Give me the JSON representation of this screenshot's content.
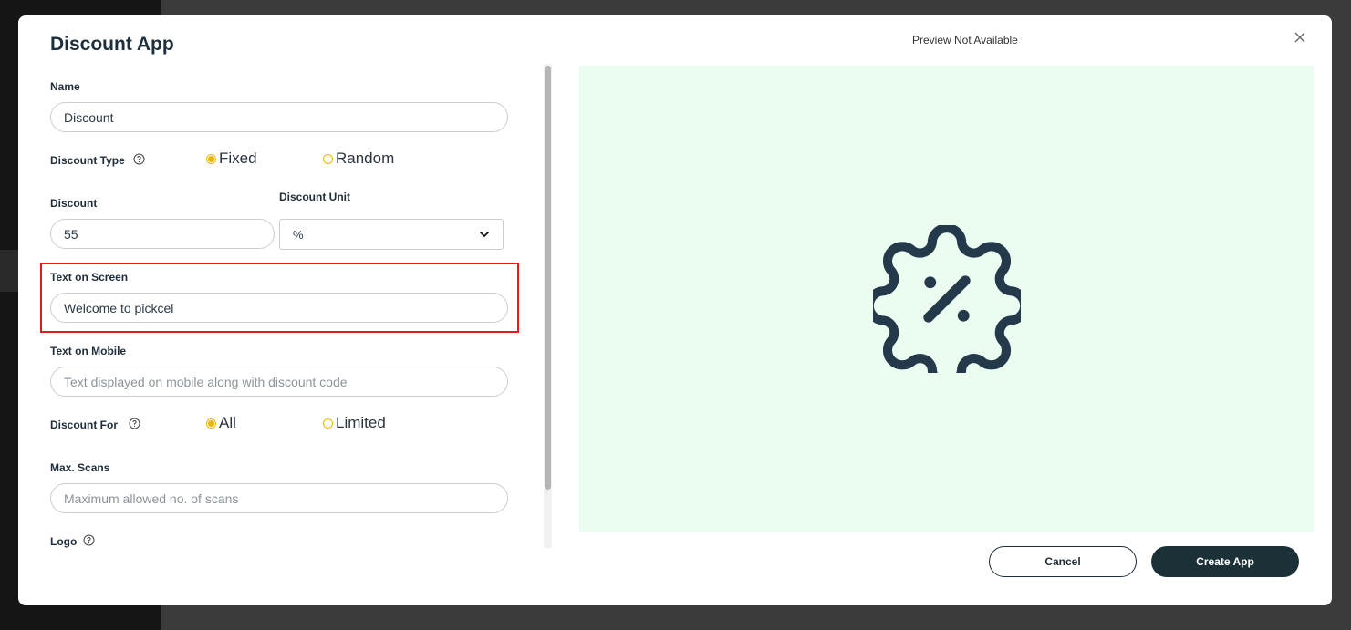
{
  "modal": {
    "title": "Discount App",
    "preview_label": "Preview Not Available"
  },
  "form": {
    "name": {
      "label": "Name",
      "value": "Discount"
    },
    "discount_type": {
      "label": "Discount Type",
      "options": [
        "Fixed",
        "Random"
      ],
      "selected": "Fixed"
    },
    "discount": {
      "label": "Discount",
      "value": "55"
    },
    "discount_unit": {
      "label": "Discount Unit",
      "value": "%"
    },
    "text_on_screen": {
      "label": "Text on Screen",
      "value": "Welcome to pickcel"
    },
    "text_on_mobile": {
      "label": "Text on Mobile",
      "placeholder": "Text displayed on mobile along with discount code"
    },
    "discount_for": {
      "label": "Discount For",
      "options": [
        "All",
        "Limited"
      ],
      "selected": "All"
    },
    "max_scans": {
      "label": "Max. Scans",
      "placeholder": "Maximum allowed no. of scans"
    },
    "logo": {
      "label": "Logo"
    }
  },
  "buttons": {
    "cancel": "Cancel",
    "create": "Create App"
  },
  "icons": {
    "close": "close-icon",
    "help": "help-circle-icon",
    "dropdown": "chevron-down-icon",
    "preview": "discount-badge-icon"
  },
  "colors": {
    "accent_radio": "#f0b400",
    "primary_button": "#1c3137",
    "preview_bg": "#ebfdf1",
    "highlight": "#e01b1b",
    "icon": "#24394a"
  }
}
